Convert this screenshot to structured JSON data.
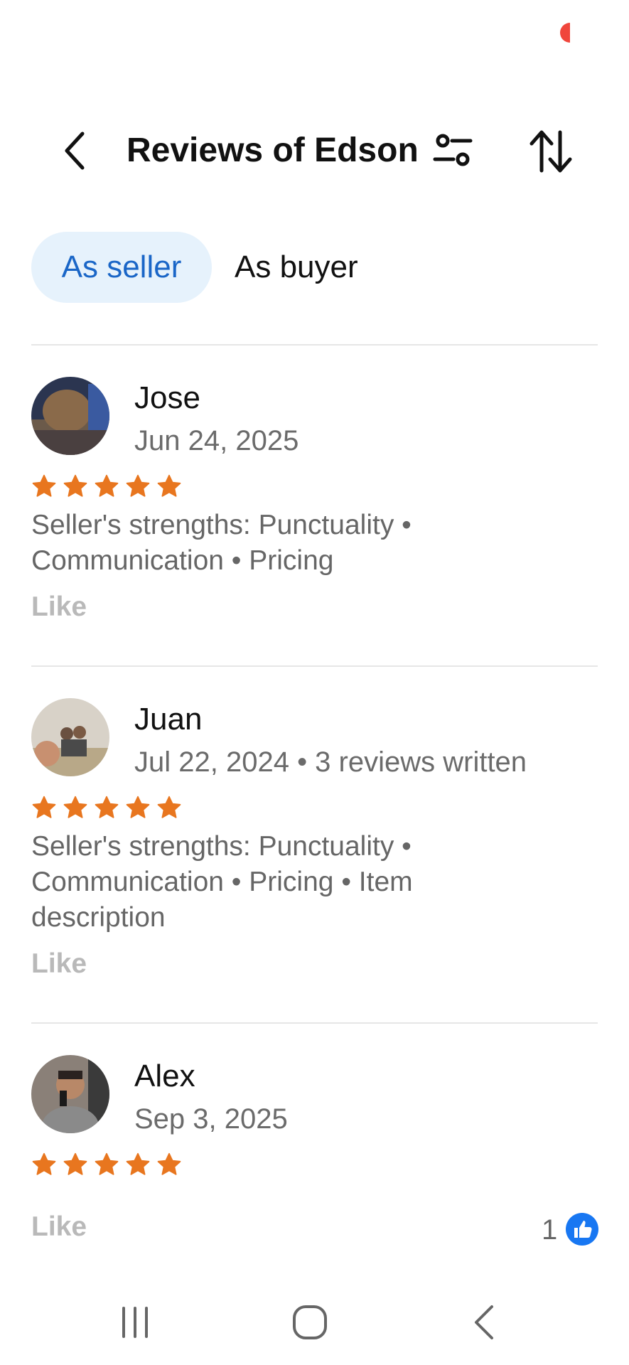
{
  "header": {
    "title": "Reviews of Edson",
    "back_icon": "chevron-left-icon",
    "filter_icon": "filter-sliders-icon",
    "sort_icon": "sort-arrows-icon"
  },
  "tabs": [
    {
      "label": "As seller",
      "active": true
    },
    {
      "label": "As buyer",
      "active": false
    }
  ],
  "colors": {
    "star": "#e8761f",
    "active_tab_bg": "#e6f2fc",
    "active_tab_text": "#1a66c7",
    "like_badge": "#1877f2",
    "status_dot": "#f0463c"
  },
  "reviews": [
    {
      "name": "Jose",
      "meta": "Jun 24, 2025",
      "rating": 5,
      "strengths": "Seller's strengths: Punctuality • Communication • Pricing",
      "like_label": "Like"
    },
    {
      "name": "Juan",
      "meta": "Jul 22, 2024 • 3 reviews written",
      "rating": 5,
      "strengths": "Seller's strengths: Punctuality • Communication • Pricing • Item description",
      "like_label": "Like"
    },
    {
      "name": "Alex",
      "meta": "Sep 3, 2025",
      "rating": 5,
      "strengths": "",
      "like_label": "Like",
      "like_count": "1"
    }
  ],
  "navbar": {
    "recent_icon": "recent-apps-icon",
    "home_icon": "home-icon",
    "back_icon": "back-icon"
  }
}
